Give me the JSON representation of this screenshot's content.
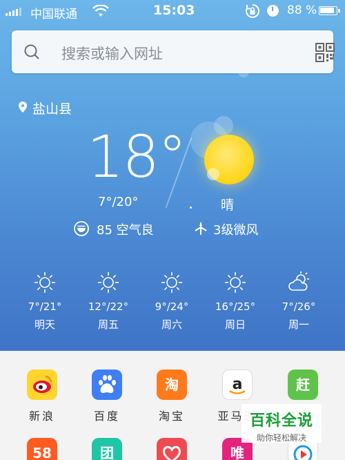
{
  "status_bar": {
    "carrier": "中国联通",
    "time": "15:03",
    "battery": "88 %"
  },
  "search": {
    "placeholder": "搜索或输入网址"
  },
  "weather": {
    "location": "盐山县",
    "temperature": "18°",
    "range": "7°/20°",
    "condition": "晴",
    "aqi": "85  空气良",
    "wind": "3级微风",
    "forecast": [
      {
        "temp": "7°/21°",
        "day": "明天",
        "icon": "sun-icon"
      },
      {
        "temp": "12°/22°",
        "day": "周五",
        "icon": "sun-icon"
      },
      {
        "temp": "9°/24°",
        "day": "周六",
        "icon": "sun-icon"
      },
      {
        "temp": "16°/25°",
        "day": "周日",
        "icon": "sun-icon"
      },
      {
        "temp": "7°/26°",
        "day": "周一",
        "icon": "partly-cloudy-icon"
      }
    ]
  },
  "apps": [
    {
      "label": "新浪",
      "icon": "sina-weibo-icon",
      "color": "#ffd52e"
    },
    {
      "label": "百度",
      "icon": "baidu-icon",
      "color": "#3f7ef5"
    },
    {
      "label": "淘宝",
      "icon": "taobao-icon",
      "color": "#ff7a1a",
      "glyph": "淘"
    },
    {
      "label": "亚马逊",
      "icon": "amazon-icon",
      "color": "#ffffff"
    },
    {
      "label": "赶集",
      "icon": "ganji-icon",
      "color": "#5fc34b",
      "glyph": "赶"
    }
  ],
  "apps_row2": [
    {
      "icon": "58-icon",
      "color": "#ff5a1f",
      "glyph": "58"
    },
    {
      "icon": "meituan-icon",
      "color": "#1fc6a5",
      "glyph": "团"
    },
    {
      "icon": "vip-heart-icon",
      "color": "#ee4a52"
    },
    {
      "icon": "vipshop-icon",
      "color": "#e5227e",
      "glyph": "唯"
    },
    {
      "icon": "video-play-icon",
      "color": "#ffffff"
    }
  ],
  "watermark": {
    "title": "百科全说",
    "subtitle": "助你轻松解决"
  }
}
